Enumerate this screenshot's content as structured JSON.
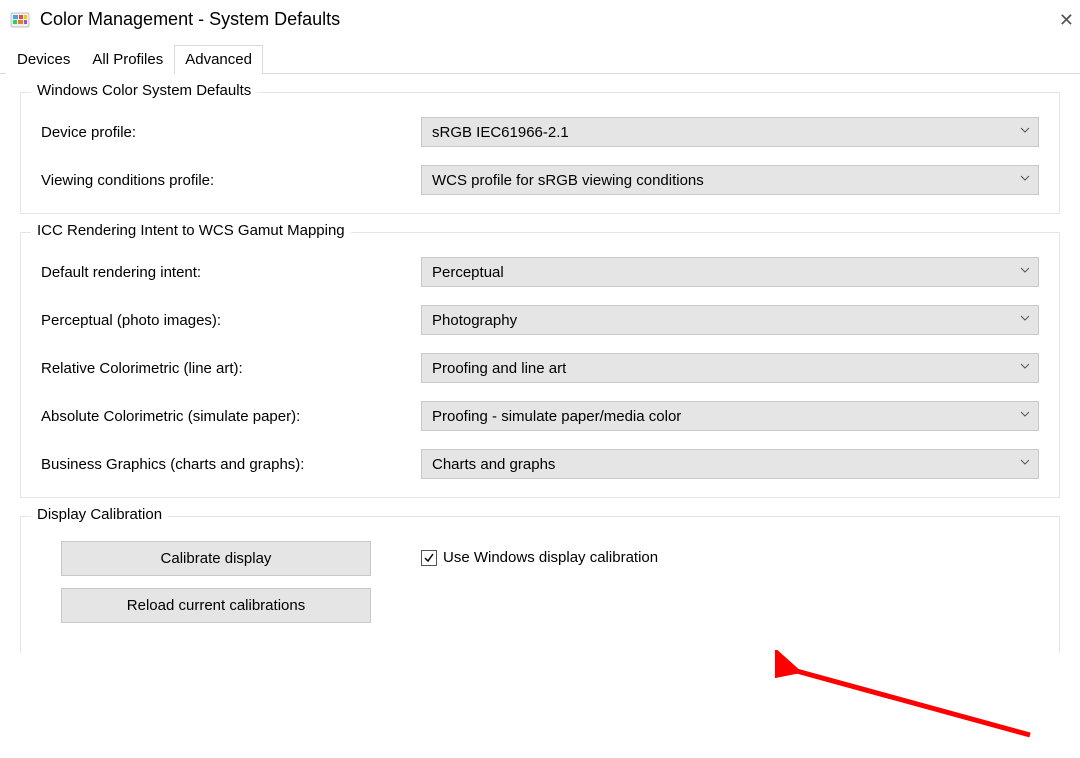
{
  "window": {
    "title": "Color Management - System Defaults"
  },
  "tabs": {
    "devices": "Devices",
    "all_profiles": "All Profiles",
    "advanced": "Advanced"
  },
  "groups": {
    "wcs_defaults": {
      "legend": "Windows Color System Defaults",
      "device_profile_label": "Device profile:",
      "device_profile_value": "sRGB IEC61966-2.1",
      "viewing_conditions_label": "Viewing conditions profile:",
      "viewing_conditions_value": "WCS profile for sRGB viewing conditions"
    },
    "icc_mapping": {
      "legend": "ICC Rendering Intent to WCS Gamut Mapping",
      "default_intent_label": "Default rendering intent:",
      "default_intent_value": "Perceptual",
      "perceptual_label": "Perceptual (photo images):",
      "perceptual_value": "Photography",
      "relative_label": "Relative Colorimetric (line art):",
      "relative_value": "Proofing and line art",
      "absolute_label": "Absolute Colorimetric (simulate paper):",
      "absolute_value": "Proofing - simulate paper/media color",
      "business_label": "Business Graphics (charts and graphs):",
      "business_value": "Charts and graphs"
    },
    "display_calibration": {
      "legend": "Display Calibration",
      "calibrate_button": "Calibrate display",
      "reload_button": "Reload current calibrations",
      "use_windows_calibration": "Use Windows display calibration"
    }
  }
}
